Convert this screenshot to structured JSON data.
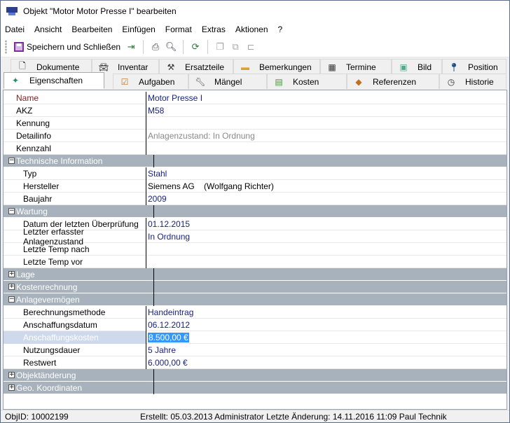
{
  "window": {
    "title": "Objekt \"Motor Motor Presse I\" bearbeiten",
    "minimize": "—",
    "maximize": "☐",
    "close": "✕"
  },
  "menu": [
    "Datei",
    "Ansicht",
    "Bearbeiten",
    "Einfügen",
    "Format",
    "Extras",
    "Aktionen",
    "?"
  ],
  "toolbar": {
    "save_label": "Speichern und Schließen"
  },
  "tabs_row1": [
    {
      "label": "Dokumente",
      "icon": "document-icon"
    },
    {
      "label": "Inventar",
      "icon": "car-icon"
    },
    {
      "label": "Ersatzteile",
      "icon": "tools-icon"
    },
    {
      "label": "Bemerkungen",
      "icon": "folder-icon"
    },
    {
      "label": "Termine",
      "icon": "calendar-icon"
    },
    {
      "label": "Bild",
      "icon": "image-icon"
    },
    {
      "label": "Position",
      "icon": "pin-icon"
    }
  ],
  "tabs_row2": [
    {
      "label": "Eigenschaften",
      "icon": "properties-icon"
    },
    {
      "label": "Aufgaben",
      "icon": "checkbox-icon"
    },
    {
      "label": "Mängel",
      "icon": "wrench-icon"
    },
    {
      "label": "Kosten",
      "icon": "money-icon"
    },
    {
      "label": "Referenzen",
      "icon": "shapes-icon"
    },
    {
      "label": "Historie",
      "icon": "clock-icon"
    }
  ],
  "props": {
    "name": {
      "k": "Name",
      "v": "Motor Presse I"
    },
    "akz": {
      "k": "AKZ",
      "v": "M58"
    },
    "kennung": {
      "k": "Kennung",
      "v": ""
    },
    "detailinfo": {
      "k": "Detailinfo",
      "v": "Anlagenzustand: In Ordnung"
    },
    "kennzahl": {
      "k": "Kennzahl",
      "v": ""
    },
    "cat_tech": "Technische Information",
    "typ": {
      "k": "Typ",
      "v": "Stahl"
    },
    "hersteller": {
      "k": "Hersteller",
      "v": "Siemens AG    (Wolfgang Richter)"
    },
    "baujahr": {
      "k": "Baujahr",
      "v": "2009"
    },
    "cat_wartung": "Wartung",
    "datum_pruef": {
      "k": "Datum der letzten Überprüfung",
      "v": "01.12.2015"
    },
    "zustand": {
      "k": "Letzter erfasster Anlagenzustand",
      "v": "In Ordnung"
    },
    "temp_nach": {
      "k": "Letzte Temp nach",
      "v": ""
    },
    "temp_vor": {
      "k": "Letzte Temp vor",
      "v": ""
    },
    "cat_lage": "Lage",
    "cat_kosten": "Kostenrechnung",
    "cat_anlage": "Anlagevermögen",
    "berechnung": {
      "k": "Berechnungsmethode",
      "v": "Handeintrag"
    },
    "anschaffungsdatum": {
      "k": "Anschaffungsdatum",
      "v": "06.12.2012"
    },
    "anschaffungskosten": {
      "k": "Anschaffungskosten",
      "v": "8.500,00 €"
    },
    "nutzungsdauer": {
      "k": "Nutzungsdauer",
      "v": "5 Jahre"
    },
    "restwert": {
      "k": "Restwert",
      "v": "6.000,00 €"
    },
    "cat_objekt": "Objektänderung",
    "cat_geo": "Geo. Koordinaten"
  },
  "status": {
    "objid": "ObjID: 10002199",
    "info": "Erstellt: 05.03.2013 Administrator  Letzte Änderung: 14.11.2016 11:09 Paul Technik"
  }
}
